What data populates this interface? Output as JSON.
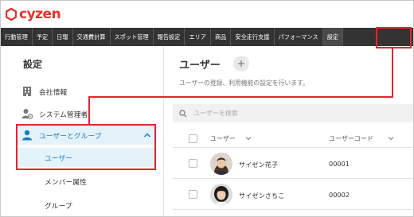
{
  "brand": {
    "name": "cyzen",
    "color": "#e6322b"
  },
  "nav": {
    "items": [
      "行動管理",
      "予定",
      "日報",
      "交通費計算",
      "スポット管理",
      "報告設定",
      "エリア",
      "商品",
      "安全走行支援",
      "パフォーマンス",
      "設定"
    ],
    "active": "設定"
  },
  "sidebar": {
    "title": "設定",
    "items": [
      {
        "label": "会社情報",
        "icon": "building-icon"
      },
      {
        "label": "システム管理者",
        "icon": "admin-user-icon"
      }
    ],
    "active_group": {
      "label": "ユーザーとグループ",
      "icon": "user-icon"
    },
    "sub_items": [
      "ユーザー",
      "メンバー属性",
      "グループ"
    ],
    "selected_sub": "ユーザー"
  },
  "main": {
    "title": "ユーザー",
    "add_icon": "plus-icon",
    "description": "ユーザーの登録、利用機能の設定を行います。",
    "search_placeholder": "ユーザーを検索",
    "columns": [
      "ユーザー",
      "ユーザーコード"
    ],
    "rows": [
      {
        "name": "サイゼン花子",
        "code": "00001"
      },
      {
        "name": "サイゼンさちこ",
        "code": "00002"
      }
    ]
  },
  "colors": {
    "accent": "#1a7cc1",
    "highlight": "#e0262d",
    "navbar": "#333333",
    "active_bg": "#e4f2fa"
  }
}
